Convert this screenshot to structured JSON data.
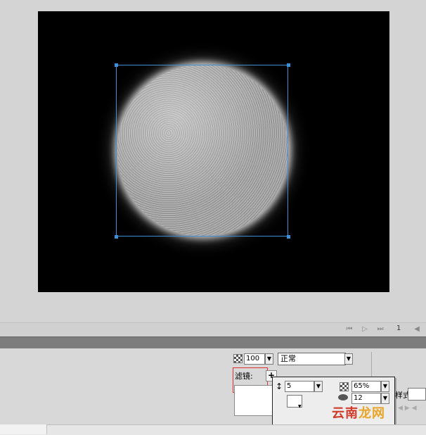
{
  "timeline": {
    "frame_number": "1",
    "controls": [
      "first-frame",
      "play",
      "last-frame",
      "prev"
    ]
  },
  "properties": {
    "alpha_value": "100",
    "blend_mode": "正常",
    "filter_label": "滤镜:",
    "add_filter": "+",
    "style_label_partial": "样式"
  },
  "filter_popup": {
    "distance_value": "5",
    "strength_value": "65%",
    "quality_value": "12"
  },
  "watermark": {
    "part1": "云南",
    "part2": "龙网"
  },
  "colors": {
    "stage_background": "#000000",
    "selection": "#3a8fd6",
    "highlight_box": "#e03030",
    "panel_header": "#7d7d7d"
  }
}
